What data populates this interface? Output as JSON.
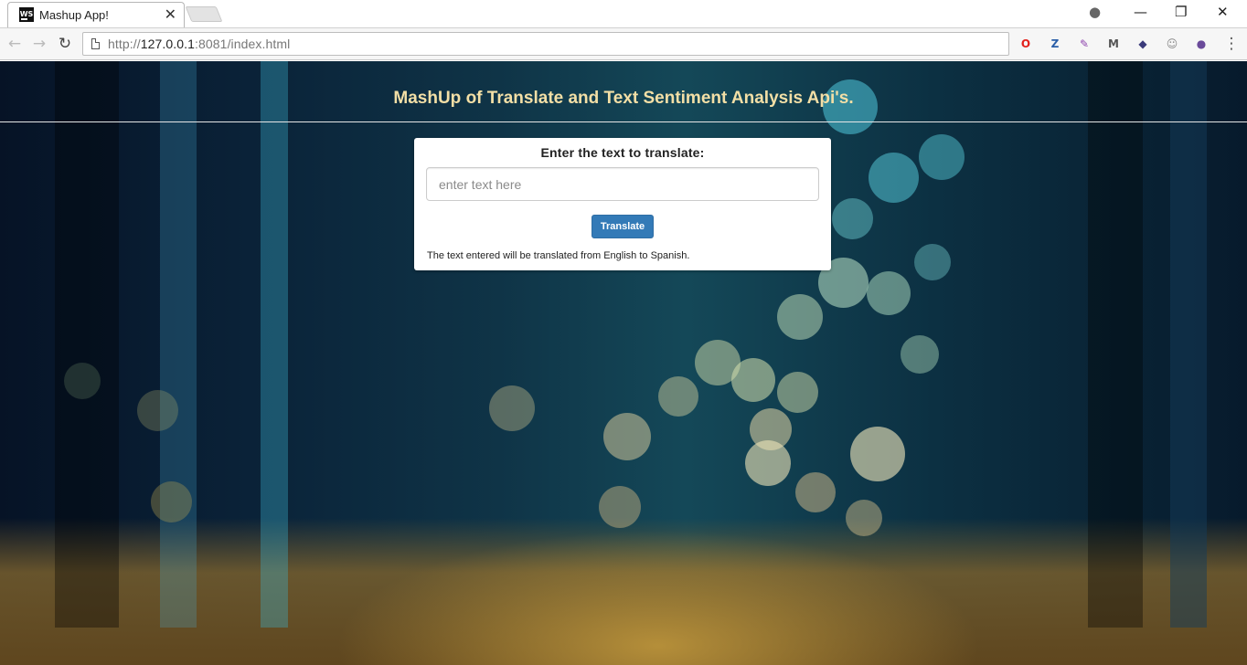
{
  "browser": {
    "tab": {
      "title": "Mashup App!",
      "favicon_text": "WS",
      "close_glyph": "✕"
    },
    "window_controls": {
      "profile": "●",
      "minimize": "—",
      "restore": "❐",
      "close": "✕"
    },
    "toolbar": {
      "back_glyph": "←",
      "forward_glyph": "→",
      "reload_glyph": "↻",
      "url_prefix": "http://",
      "url_host": "127.0.0.1",
      "url_rest": ":8081/index.html",
      "menu_glyph": "⋮"
    },
    "extensions": [
      {
        "icon": "opera-icon",
        "glyph": "O",
        "color": "#e2211c"
      },
      {
        "icon": "z-extension-icon",
        "glyph": "Z",
        "color": "#2b5fa8"
      },
      {
        "icon": "quill-icon",
        "glyph": "✎",
        "color": "#8e44ad"
      },
      {
        "icon": "m-extension-icon",
        "glyph": "M",
        "color": "#555555"
      },
      {
        "icon": "bookmark-extension-icon",
        "glyph": "◆",
        "color": "#3a3a7a"
      },
      {
        "icon": "emoji-extension-icon",
        "glyph": "☺",
        "color": "#888888"
      },
      {
        "icon": "ghost-extension-icon",
        "glyph": "●",
        "color": "#6a4a9a"
      }
    ]
  },
  "page": {
    "header_title": "MashUp of Translate and Text Sentiment Analysis Api's.",
    "form": {
      "label": "Enter the text to translate:",
      "input_placeholder": "enter text here",
      "input_value": "",
      "button_label": "Translate",
      "hint": "The text entered will be translated from English to Spanish."
    },
    "colors": {
      "accent": "#337ab7",
      "header_text": "#f3dfa6"
    }
  }
}
